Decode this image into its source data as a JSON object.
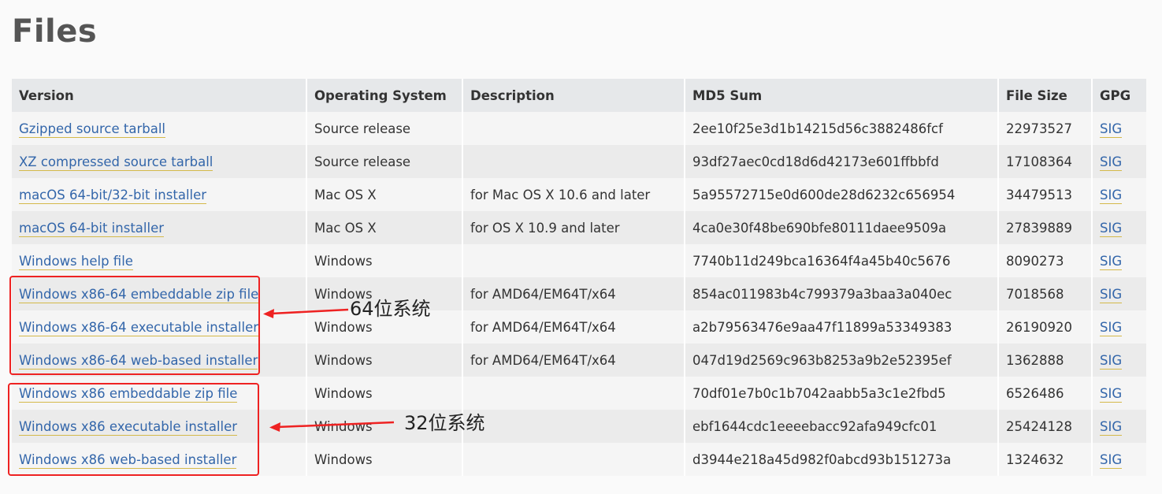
{
  "page": {
    "title": "Files"
  },
  "table": {
    "headers": [
      "Version",
      "Operating System",
      "Description",
      "MD5 Sum",
      "File Size",
      "GPG"
    ],
    "rows": [
      {
        "version": "Gzipped source tarball",
        "os": "Source release",
        "description": "",
        "md5": "2ee10f25e3d1b14215d56c3882486fcf",
        "size": "22973527",
        "gpg": "SIG"
      },
      {
        "version": "XZ compressed source tarball",
        "os": "Source release",
        "description": "",
        "md5": "93df27aec0cd18d6d42173e601ffbbfd",
        "size": "17108364",
        "gpg": "SIG"
      },
      {
        "version": "macOS 64-bit/32-bit installer",
        "os": "Mac OS X",
        "description": "for Mac OS X 10.6 and later",
        "md5": "5a95572715e0d600de28d6232c656954",
        "size": "34479513",
        "gpg": "SIG"
      },
      {
        "version": "macOS 64-bit installer",
        "os": "Mac OS X",
        "description": "for OS X 10.9 and later",
        "md5": "4ca0e30f48be690bfe80111daee9509a",
        "size": "27839889",
        "gpg": "SIG"
      },
      {
        "version": "Windows help file",
        "os": "Windows",
        "description": "",
        "md5": "7740b11d249bca16364f4a45b40c5676",
        "size": "8090273",
        "gpg": "SIG"
      },
      {
        "version": "Windows x86-64 embeddable zip file",
        "os": "Windows",
        "description": "for AMD64/EM64T/x64",
        "md5": "854ac011983b4c799379a3baa3a040ec",
        "size": "7018568",
        "gpg": "SIG"
      },
      {
        "version": "Windows x86-64 executable installer",
        "os": "Windows",
        "description": "for AMD64/EM64T/x64",
        "md5": "a2b79563476e9aa47f11899a53349383",
        "size": "26190920",
        "gpg": "SIG"
      },
      {
        "version": "Windows x86-64 web-based installer",
        "os": "Windows",
        "description": "for AMD64/EM64T/x64",
        "md5": "047d19d2569c963b8253a9b2e52395ef",
        "size": "1362888",
        "gpg": "SIG"
      },
      {
        "version": "Windows x86 embeddable zip file",
        "os": "Windows",
        "description": "",
        "md5": "70df01e7b0c1b7042aabb5a3c1e2fbd5",
        "size": "6526486",
        "gpg": "SIG"
      },
      {
        "version": "Windows x86 executable installer",
        "os": "Windows",
        "description": "",
        "md5": "ebf1644cdc1eeeebacc92afa949cfc01",
        "size": "25424128",
        "gpg": "SIG"
      },
      {
        "version": "Windows x86 web-based installer",
        "os": "Windows",
        "description": "",
        "md5": "d3944e218a45d982f0abcd93b151273a",
        "size": "1324632",
        "gpg": "SIG"
      }
    ]
  },
  "annotations": {
    "label_64": "64位系统",
    "label_32": "32位系统",
    "color": "#ee2222"
  },
  "colors": {
    "link": "#3366aa",
    "header_bg": "#e6e8ea"
  }
}
